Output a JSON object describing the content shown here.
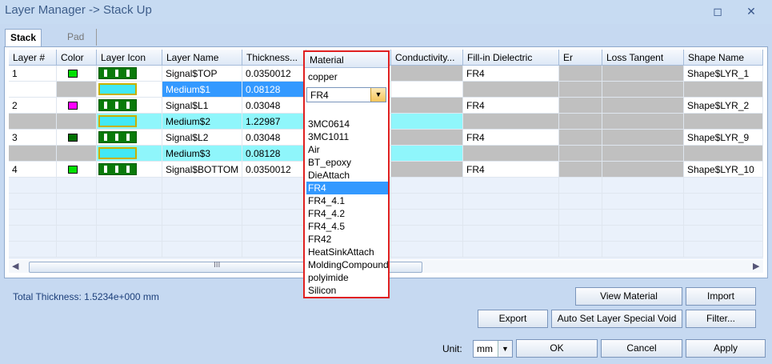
{
  "window": {
    "title": "Layer Manager -> Stack Up",
    "restore_label": "◻",
    "close_label": "✕"
  },
  "tabs": [
    {
      "label": "Stack Up"
    },
    {
      "label": "Pad Stack"
    }
  ],
  "columns": [
    "Layer #",
    "Color",
    "Layer Icon",
    "Layer Name",
    "Thickness...",
    "Material",
    "Conductivity...",
    "Fill-in Dielectric",
    "Er",
    "Loss Tangent",
    "Shape Name"
  ],
  "rows": [
    {
      "num": "1",
      "color": "#00e000",
      "type": "signal",
      "name": "Signal$TOP",
      "thickness": "0.0350012",
      "material": "copper",
      "fill": "FR4",
      "shape": "Shape$LYR_1"
    },
    {
      "num": "",
      "color": "",
      "type": "medium",
      "name": "Medium$1",
      "thickness": "0.08128",
      "material": "FR4",
      "fill": "",
      "shape": ""
    },
    {
      "num": "2",
      "color": "#ff00ff",
      "type": "signal",
      "name": "Signal$L1",
      "thickness": "0.03048",
      "material": "",
      "fill": "FR4",
      "shape": "Shape$LYR_2"
    },
    {
      "num": "",
      "color": "",
      "type": "medium",
      "name": "Medium$2",
      "thickness": "1.22987",
      "material": "",
      "fill": "",
      "shape": ""
    },
    {
      "num": "3",
      "color": "#007000",
      "type": "signal",
      "name": "Signal$L2",
      "thickness": "0.03048",
      "material": "",
      "fill": "FR4",
      "shape": "Shape$LYR_9"
    },
    {
      "num": "",
      "color": "",
      "type": "medium",
      "name": "Medium$3",
      "thickness": "0.08128",
      "material": "",
      "fill": "",
      "shape": ""
    },
    {
      "num": "4",
      "color": "#00e000",
      "type": "signal",
      "name": "Signal$BOTTOM",
      "thickness": "0.0350012",
      "material": "",
      "fill": "FR4",
      "shape": "Shape$LYR_10"
    }
  ],
  "material_dropdown": {
    "header": "Material",
    "top_value": "copper",
    "combo_value": "FR4",
    "options": [
      "3MC0614",
      "3MC1011",
      "Air",
      "BT_epoxy",
      "DieAttach",
      "FR4",
      "FR4_4.1",
      "FR4_4.2",
      "FR4_4.5",
      "FR42",
      "HeatSinkAttach",
      "MoldingCompound",
      "polyimide",
      "Silicon"
    ],
    "selected": "FR4"
  },
  "scrollbar": {
    "grip": "III",
    "left_arrow": "◀",
    "right_arrow": "▶"
  },
  "total_thickness": "Total Thickness: 1.5234e+000 mm",
  "buttons": {
    "view_material": "View Material",
    "import": "Import",
    "export": "Export",
    "auto_set": "Auto Set Layer Special Void",
    "filter": "Filter...",
    "ok": "OK",
    "cancel": "Cancel",
    "apply": "Apply"
  },
  "unit": {
    "label": "Unit:",
    "value": "mm"
  }
}
